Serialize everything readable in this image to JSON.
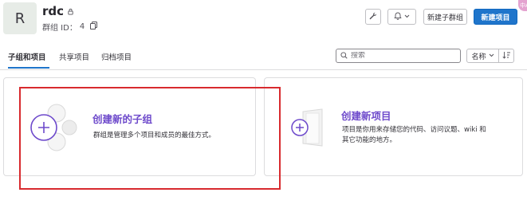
{
  "group": {
    "avatar_letter": "R",
    "name": "rdc",
    "id_label": "群组 ID：",
    "id_value": "4"
  },
  "toolbar": {
    "new_subgroup_label": "新建子群组",
    "new_project_label": "新建项目"
  },
  "badge_text": "中A",
  "tabs": [
    {
      "label": "子组和项目",
      "active": true
    },
    {
      "label": "共享项目",
      "active": false
    },
    {
      "label": "归档项目",
      "active": false
    }
  ],
  "search": {
    "placeholder": "搜索"
  },
  "sort": {
    "label": "名称"
  },
  "cards": {
    "subgroup": {
      "title": "创建新的子组",
      "description": "群组是管理多个项目和成员的最佳方式。"
    },
    "project": {
      "title": "创建新项目",
      "description_line1": "项目是你用来存储您的代码、访问议题、wiki 和",
      "description_line2": "其它功能的地方。"
    }
  },
  "colors": {
    "primary_button": "#1f75cb",
    "card_title": "#6d49cb",
    "highlight_border": "#d82a2e"
  }
}
